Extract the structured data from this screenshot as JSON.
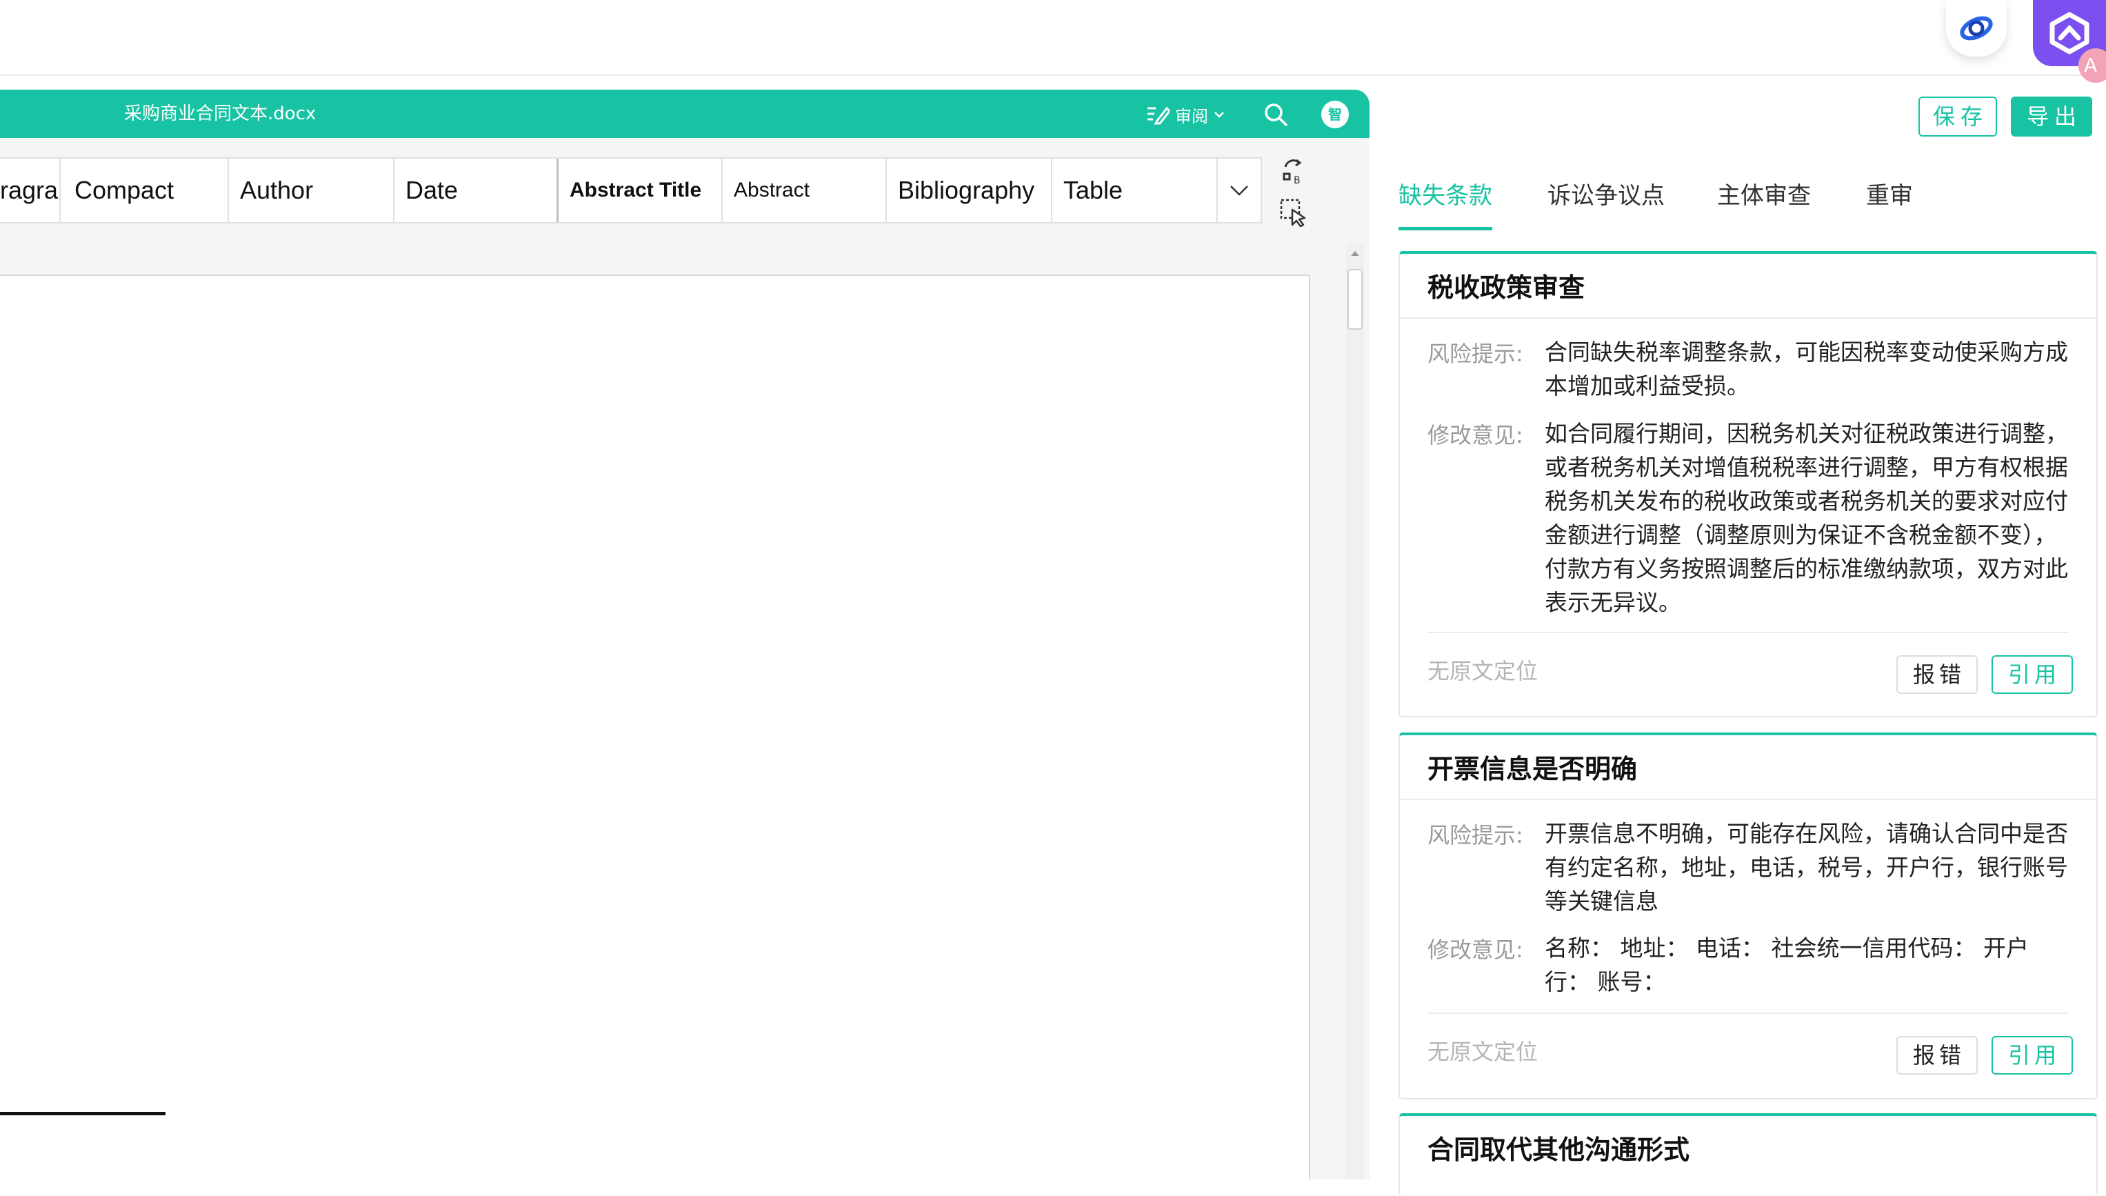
{
  "editor": {
    "doc_title": "采购商业合同文本.docx",
    "review_label": "审阅",
    "avatar_label": "智",
    "styles": [
      "ragra",
      "Compact",
      "Author",
      "Date",
      "Abstract Title",
      "Abstract",
      "Bibliography",
      "Table"
    ]
  },
  "actions": {
    "save": "保存",
    "export": "导出"
  },
  "tabs": [
    {
      "label": "缺失条款",
      "active": true
    },
    {
      "label": "诉讼争议点",
      "active": false
    },
    {
      "label": "主体审查",
      "active": false
    },
    {
      "label": "重审",
      "active": false
    }
  ],
  "cards": [
    {
      "title": "税收政策审查",
      "risk_label": "风险提示:",
      "risk_text": "合同缺失税率调整条款，可能因税率变动使采购方成本增加或利益受损。",
      "advice_label": "修改意见:",
      "advice_text": "如合同履行期间，因税务机关对征税政策进行调整，或者税务机关对增值税税率进行调整，甲方有权根据税务机关发布的税收政策或者税务机关的要求对应付金额进行调整（调整原则为保证不含税金额不变），付款方有义务按照调整后的标准缴纳款项，双方对此表示无异议。",
      "no_locate": "无原文定位",
      "report": "报错",
      "cite": "引用"
    },
    {
      "title": "开票信息是否明确",
      "risk_label": "风险提示:",
      "risk_text": "开票信息不明确，可能存在风险，请确认合同中是否有约定名称，地址，电话，税号，开户行，银行账号等关键信息",
      "advice_label": "修改意见:",
      "advice_text": "名称：  地址：  电话：  社会统一信用代码：  开户行：  账号：",
      "no_locate": "无原文定位",
      "report": "报错",
      "cite": "引用"
    },
    {
      "title": "合同取代其他沟通形式"
    }
  ],
  "colors": {
    "accent": "#17c3a3",
    "assistant": "#7b4ff0"
  }
}
